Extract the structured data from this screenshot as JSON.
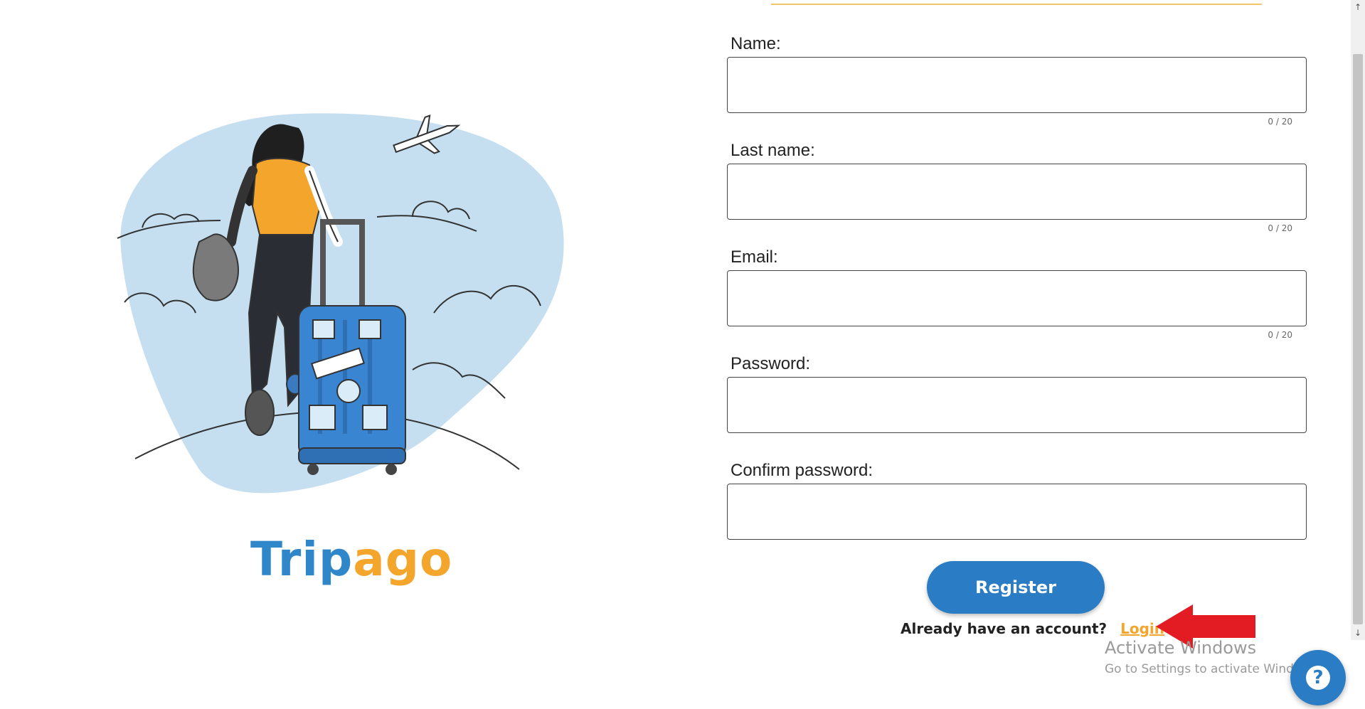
{
  "brand": {
    "part1": "Trip",
    "part2": "ago"
  },
  "form": {
    "fields": [
      {
        "label": "Name:",
        "value": "",
        "counter": "0 / 20"
      },
      {
        "label": "Last name:",
        "value": "",
        "counter": "0 / 20"
      },
      {
        "label": "Email:",
        "value": "",
        "counter": "0 / 20"
      },
      {
        "label": "Password:",
        "value": ""
      },
      {
        "label": "Confirm password:",
        "value": ""
      }
    ],
    "register_label": "Register",
    "account_prompt": "Already have an account?",
    "login_label": "Login"
  },
  "windows_notice": {
    "title": "Activate Windows",
    "subtitle": "Go to Settings to activate Windows."
  },
  "help": {
    "glyph": "?"
  },
  "scrollbar": {
    "up": "↑",
    "down": "↓"
  },
  "colors": {
    "brand_blue": "#2f86c9",
    "brand_orange": "#f4a52c",
    "button_blue": "#2a7cc4",
    "arrow_red": "#e31b23"
  }
}
